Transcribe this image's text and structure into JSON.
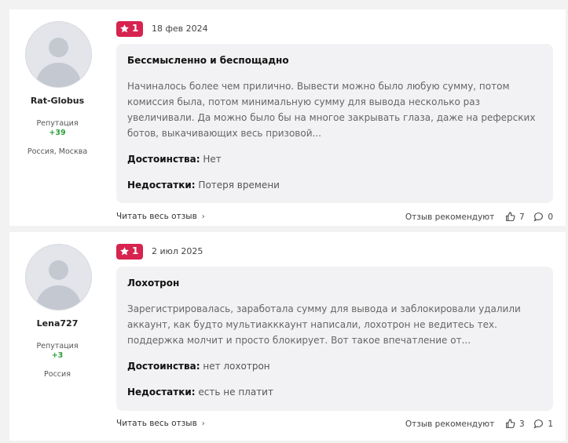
{
  "reviews": [
    {
      "author": {
        "name": "Rat-Globus",
        "rep_label": "Репутация",
        "rep_value": "+39",
        "location": "Россия, Москва"
      },
      "rating": "1",
      "date": "18 фев 2024",
      "title": "Бессмысленно и беспощадно",
      "text": "Начиналось более чем прилично. Вывести можно было любую сумму, потом комиссия была, потом минимальную сумму для вывода несколько раз увеличивали. Да можно было бы на многое закрывать глаза, даже на реферских ботов, выкачивающих весь призовой...",
      "pros_label": "Достоинства:",
      "pros": "Нет",
      "cons_label": "Недостатки:",
      "cons": "Потеря времени",
      "read_more": "Читать весь отзыв",
      "recommend_label": "Отзыв рекомендуют",
      "likes": "7",
      "comments": "0"
    },
    {
      "author": {
        "name": "Lena727",
        "rep_label": "Репутация",
        "rep_value": "+3",
        "location": "Россия"
      },
      "rating": "1",
      "date": "2 июл 2025",
      "title": "Лохотрон",
      "text": "Зарегистрировалась, заработала сумму для вывода и заблокировали удалили аккаунт, как будто мультиакккаунт написали, лохотрон не ведитесь тех. поддержка молчит и просто блокирует. Вот такое впечатление от...",
      "pros_label": "Достоинства:",
      "pros": "нет лохотрон",
      "cons_label": "Недостатки:",
      "cons": "есть не платит",
      "read_more": "Читать весь отзыв",
      "recommend_label": "Отзыв рекомендуют",
      "likes": "3",
      "comments": "1"
    }
  ],
  "colors": {
    "badge": "#d6234f",
    "reputation": "#2e9e3a",
    "review_bg": "#f2f2f4"
  },
  "icons": [
    "star-icon",
    "chevron-right-icon",
    "thumbs-up-icon",
    "comment-icon",
    "avatar-placeholder"
  ]
}
